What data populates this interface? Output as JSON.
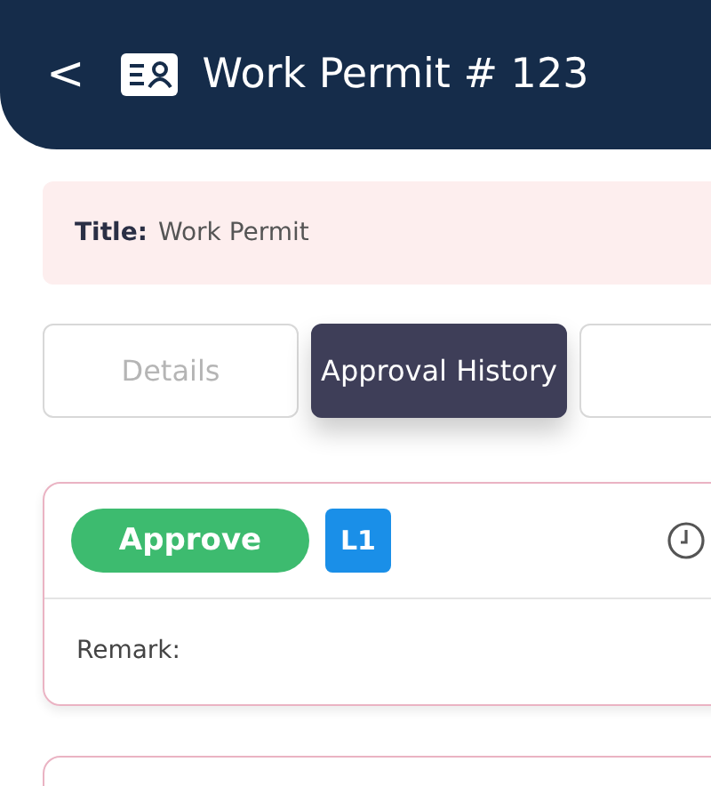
{
  "header": {
    "back": "<",
    "title": "Work Permit # 123"
  },
  "title_field": {
    "label": "Title:",
    "value": "Work Permit"
  },
  "tabs": [
    {
      "label": "Details",
      "selected": false
    },
    {
      "label": "Approval History",
      "selected": true
    }
  ],
  "approvals": [
    {
      "status": "Approve",
      "level": "L1",
      "remark_label": "Remark:"
    }
  ]
}
